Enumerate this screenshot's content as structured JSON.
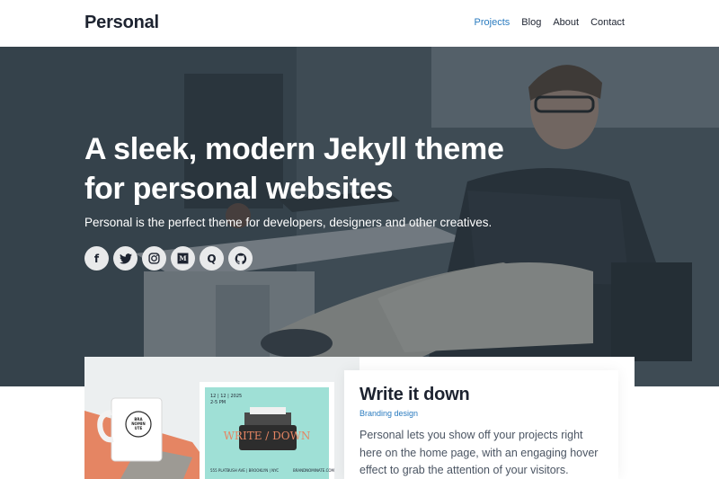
{
  "header": {
    "brand": "Personal",
    "nav": [
      {
        "label": "Projects",
        "active": true
      },
      {
        "label": "Blog"
      },
      {
        "label": "About"
      },
      {
        "label": "Contact"
      }
    ]
  },
  "hero": {
    "title_line1": "A sleek, modern Jekyll theme",
    "title_line2": "for personal websites",
    "subtitle": "Personal is the perfect theme for developers, designers and other creatives.",
    "socials": [
      {
        "icon": "facebook-icon",
        "glyph": "f"
      },
      {
        "icon": "twitter-icon",
        "glyph": "t"
      },
      {
        "icon": "instagram-icon",
        "glyph": "◎"
      },
      {
        "icon": "medium-icon",
        "glyph": "M"
      },
      {
        "icon": "quora-icon",
        "glyph": "Q"
      },
      {
        "icon": "github-icon",
        "glyph": "●"
      }
    ]
  },
  "project": {
    "title": "Write it down",
    "category": "Branding design",
    "description": "Personal lets you show off your projects right here on the home page, with an engaging hover effect to grab the attention of your visitors.",
    "image_text": {
      "mug": "BRA NOMIN UTE",
      "poster_date": "12 | 12 | 2025",
      "poster_time": "2-5 PM",
      "poster_title": "WRITE / DOWN",
      "poster_footer": "555 PLATBUSH AVE | BROOKLYN | NYC",
      "poster_url": "BRANDNOMINATE.COM"
    }
  },
  "colors": {
    "accent": "#2a7bbf",
    "heading": "#1d2330",
    "hero_overlay": "#28343e"
  }
}
